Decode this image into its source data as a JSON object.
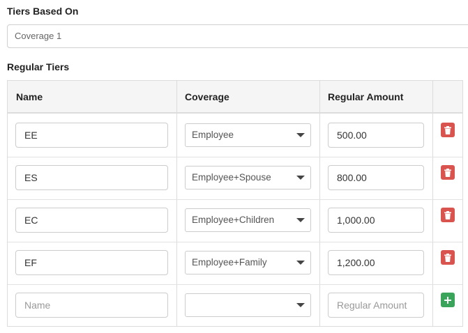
{
  "tiers_based_on": {
    "label": "Tiers Based On",
    "value": "Coverage 1"
  },
  "regular_tiers": {
    "label": "Regular Tiers",
    "columns": [
      "Name",
      "Coverage",
      "Regular Amount"
    ],
    "rows": [
      {
        "name": "EE",
        "coverage": "Employee",
        "amount": "500.00"
      },
      {
        "name": "ES",
        "coverage": "Employee+Spouse",
        "amount": "800.00"
      },
      {
        "name": "EC",
        "coverage": "Employee+Children",
        "amount": "1,000.00"
      },
      {
        "name": "EF",
        "coverage": "Employee+Family",
        "amount": "1,200.00"
      }
    ],
    "new_row": {
      "name_placeholder": "Name",
      "coverage_value": "",
      "amount_placeholder": "Regular Amount"
    }
  },
  "icons": {
    "delete": "trash-icon",
    "add": "plus-icon"
  },
  "colors": {
    "delete_button": "#d9534f",
    "add_button": "#3aa45a",
    "header_bg": "#f5f5f5"
  }
}
